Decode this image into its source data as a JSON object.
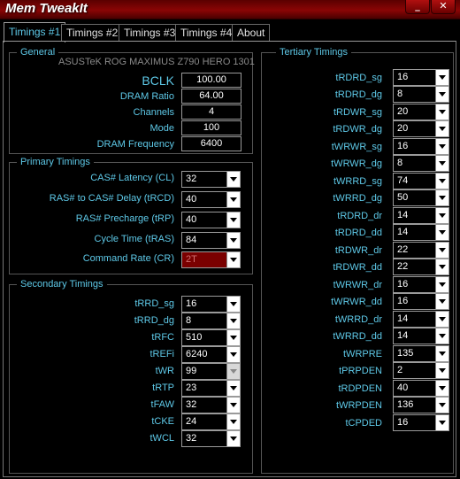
{
  "window": {
    "title": "Mem TweakIt",
    "minimize_label": "_",
    "close_label": "✕"
  },
  "tabs": [
    {
      "label": "Timings #1",
      "active": true
    },
    {
      "label": "Timings #2",
      "active": false
    },
    {
      "label": "Timings #3",
      "active": false
    },
    {
      "label": "Timings #4",
      "active": false
    },
    {
      "label": "About",
      "active": false
    }
  ],
  "general": {
    "title": "General",
    "board": "ASUSTeK ROG MAXIMUS Z790 HERO 1301",
    "fields": [
      {
        "label": "BCLK",
        "value": "100.00"
      },
      {
        "label": "DRAM Ratio",
        "value": "64.00"
      },
      {
        "label": "Channels",
        "value": "4"
      },
      {
        "label": "Mode",
        "value": "100"
      },
      {
        "label": "DRAM Frequency",
        "value": "6400"
      }
    ]
  },
  "primary": {
    "title": "Primary Timings",
    "fields": [
      {
        "label": "CAS# Latency (CL)",
        "value": "32"
      },
      {
        "label": "RAS# to CAS# Delay (tRCD)",
        "value": "40"
      },
      {
        "label": "RAS# Precharge (tRP)",
        "value": "40"
      },
      {
        "label": "Cycle Time (tRAS)",
        "value": "84"
      },
      {
        "label": "Command Rate (CR)",
        "value": "2T"
      }
    ]
  },
  "secondary": {
    "title": "Secondary Timings",
    "fields": [
      {
        "label": "tRRD_sg",
        "value": "16"
      },
      {
        "label": "tRRD_dg",
        "value": "8"
      },
      {
        "label": "tRFC",
        "value": "510"
      },
      {
        "label": "tREFi",
        "value": "6240"
      },
      {
        "label": "tWR",
        "value": "99"
      },
      {
        "label": "tRTP",
        "value": "23"
      },
      {
        "label": "tFAW",
        "value": "32"
      },
      {
        "label": "tCKE",
        "value": "24"
      },
      {
        "label": "tWCL",
        "value": "32"
      }
    ]
  },
  "tertiary": {
    "title": "Tertiary Timings",
    "fields": [
      {
        "label": "tRDRD_sg",
        "value": "16"
      },
      {
        "label": "tRDRD_dg",
        "value": "8"
      },
      {
        "label": "tRDWR_sg",
        "value": "20"
      },
      {
        "label": "tRDWR_dg",
        "value": "20"
      },
      {
        "label": "tWRWR_sg",
        "value": "16"
      },
      {
        "label": "tWRWR_dg",
        "value": "8"
      },
      {
        "label": "tWRRD_sg",
        "value": "74"
      },
      {
        "label": "tWRRD_dg",
        "value": "50"
      },
      {
        "label": "tRDRD_dr",
        "value": "14"
      },
      {
        "label": "tRDRD_dd",
        "value": "14"
      },
      {
        "label": "tRDWR_dr",
        "value": "22"
      },
      {
        "label": "tRDWR_dd",
        "value": "22"
      },
      {
        "label": "tWRWR_dr",
        "value": "16"
      },
      {
        "label": "tWRWR_dd",
        "value": "16"
      },
      {
        "label": "tWRRD_dr",
        "value": "14"
      },
      {
        "label": "tWRRD_dd",
        "value": "14"
      },
      {
        "label": "tWRPRE",
        "value": "135"
      },
      {
        "label": "tPRPDEN",
        "value": "2"
      },
      {
        "label": "tRDPDEN",
        "value": "40"
      },
      {
        "label": "tWRPDEN",
        "value": "136"
      },
      {
        "label": "tCPDED",
        "value": "16"
      }
    ]
  }
}
